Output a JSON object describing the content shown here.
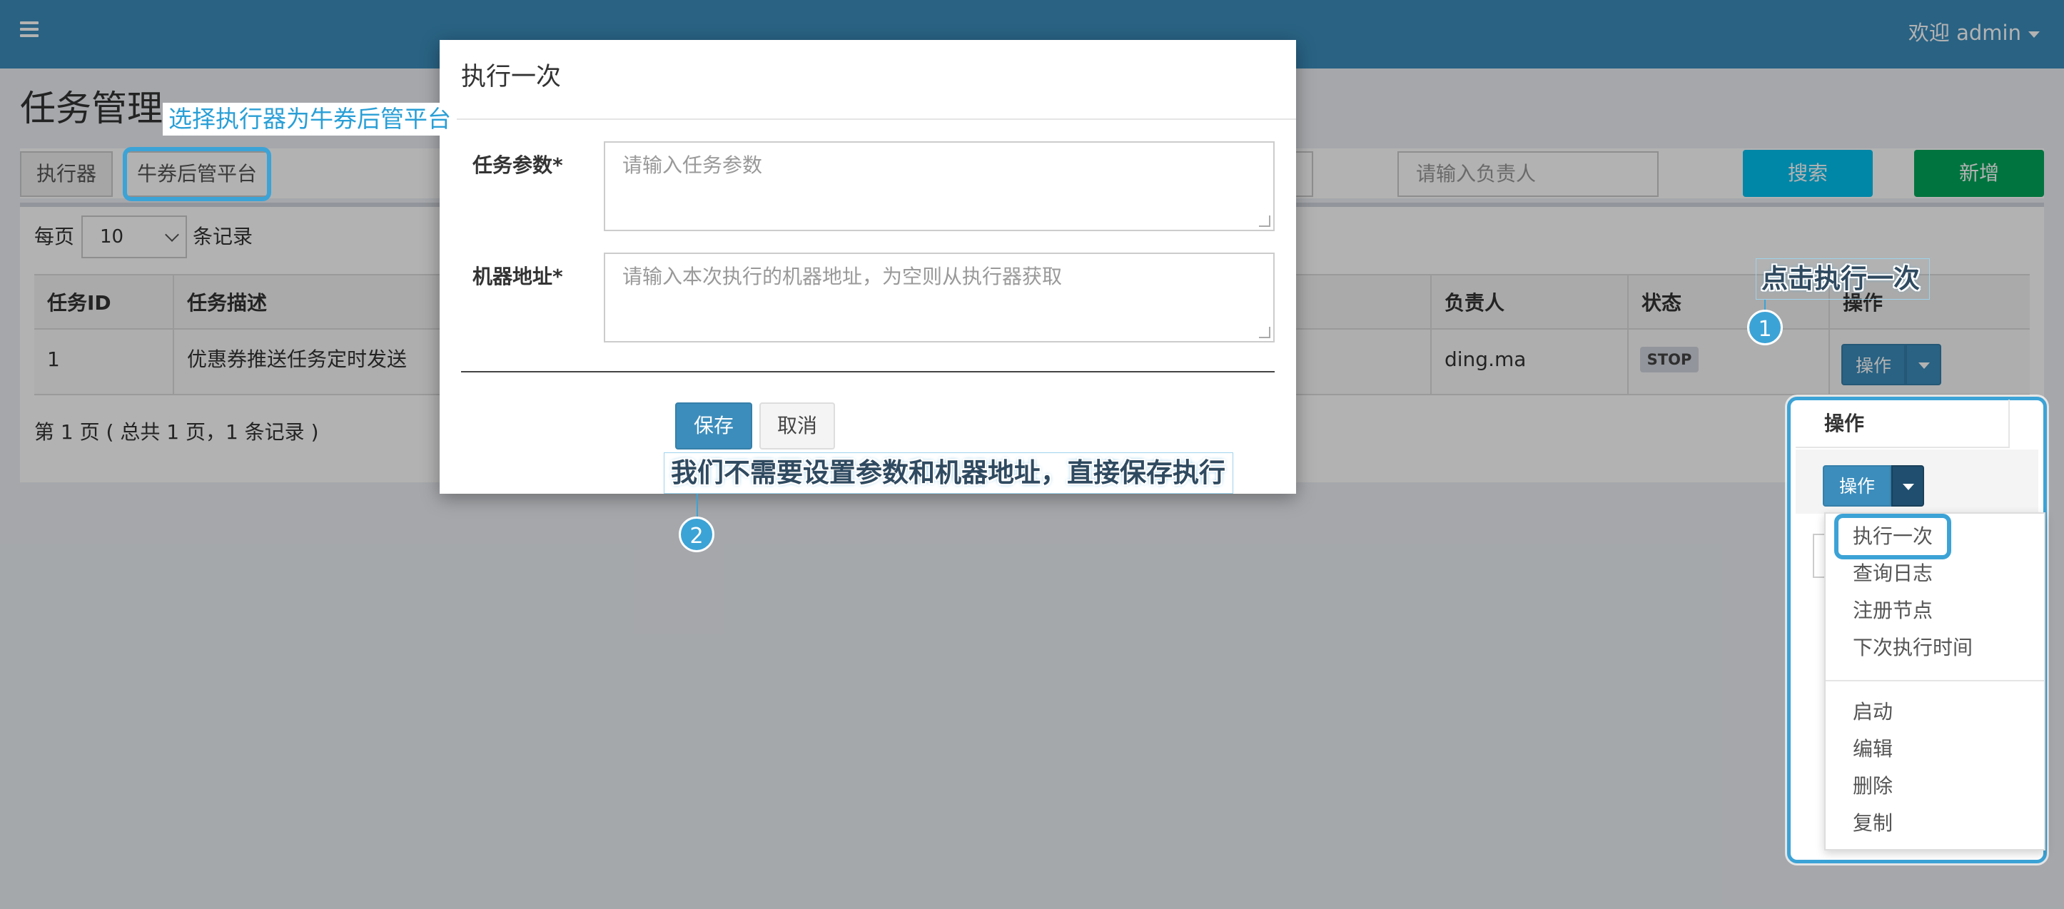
{
  "header": {
    "welcome": "欢迎 admin"
  },
  "page": {
    "title": "任务管理"
  },
  "filters": {
    "executor_label": "执行器",
    "executor_value": "牛券后管平台",
    "owner_placeholder": "请输入负责人",
    "search_label": "搜索",
    "add_label": "新增"
  },
  "table": {
    "per_page_prefix": "每页",
    "per_page_value": "10",
    "per_page_suffix": "条记录",
    "columns": [
      "任务ID",
      "任务描述",
      "负责人",
      "状态",
      "操作"
    ],
    "rows": [
      {
        "id": "1",
        "desc": "优惠券推送任务定时发送",
        "owner": "ding.ma",
        "status": "STOP",
        "action": "操作"
      }
    ],
    "pagination": "第 1 页 ( 总共 1 页，1 条记录 )"
  },
  "modal": {
    "title": "执行一次",
    "param_label": "任务参数*",
    "param_placeholder": "请输入任务参数",
    "address_label": "机器地址*",
    "address_placeholder": "请输入本次执行的机器地址，为空则从执行器获取",
    "save_label": "保存",
    "cancel_label": "取消"
  },
  "dropdown": {
    "header": "操作",
    "button": "操作",
    "items_group1": [
      "执行一次",
      "查询日志",
      "注册节点",
      "下次执行时间"
    ],
    "items_group2": [
      "启动",
      "编辑",
      "删除",
      "复制"
    ]
  },
  "annotations": {
    "hint_executor": "选择执行器为牛券后管平台",
    "hint_step1": "点击执行一次",
    "hint_step2": "我们不需要设置参数和机器地址，直接保存执行",
    "badge1": "1",
    "badge2": "2",
    "accent_color": "#3ca3d6"
  }
}
